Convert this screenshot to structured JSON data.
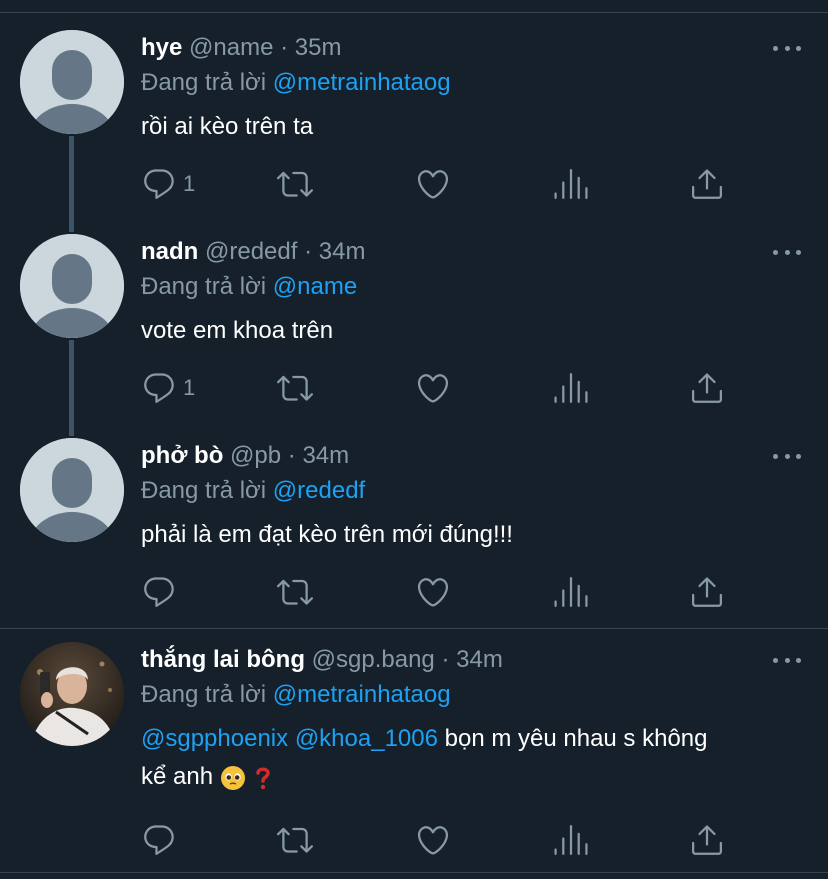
{
  "tweets": [
    {
      "name": "hye",
      "handle": "@name",
      "time": "35m",
      "reply_prefix": "Đang trả lời",
      "reply_to": "@metrainhataog",
      "text": "rồi ai kèo trên ta",
      "reply_count": "1"
    },
    {
      "name": "nadn",
      "handle": "@rededf",
      "time": "34m",
      "reply_prefix": "Đang trả lời",
      "reply_to": "@name",
      "text": "vote em khoa trên",
      "reply_count": "1"
    },
    {
      "name": "phở bò",
      "handle": "@pb",
      "time": "34m",
      "reply_prefix": "Đang trả lời",
      "reply_to": "@rededf",
      "text": "phải là em đạt kèo trên mới đúng!!!",
      "reply_count": ""
    },
    {
      "name": "thắng lai bông",
      "handle": "@sgp.bang",
      "time": "34m",
      "reply_prefix": "Đang trả lời",
      "reply_to": "@metrainhataog",
      "mention1": "@sgpphoenix",
      "mention2": "@khoa_1006",
      "text_part1": " bọn m yêu nhau s không",
      "text_part2": "kể anh",
      "reply_count": ""
    }
  ],
  "separator_dot": "·",
  "icons": [
    "reply-icon",
    "retweet-icon",
    "like-icon",
    "analytics-icon",
    "share-icon",
    "more-icon",
    "pleading-face-emoji",
    "red-question-mark-emoji"
  ],
  "colors": {
    "background": "#15202b",
    "mention": "#1da1f2",
    "muted": "#8899a6",
    "divider": "#38444d",
    "thread_line": "#3d5466"
  }
}
